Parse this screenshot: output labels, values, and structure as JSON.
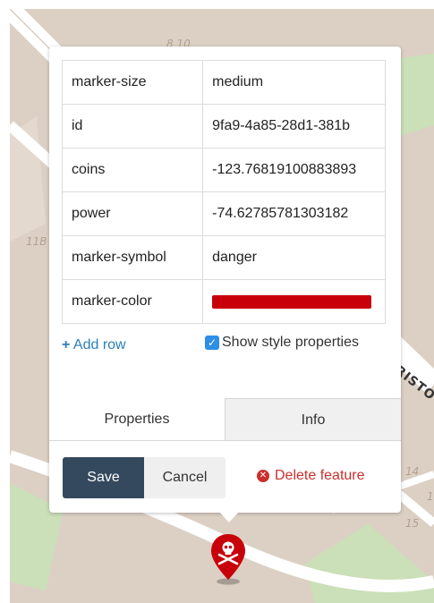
{
  "map": {
    "labels": [
      "8 10",
      "11B",
      "14",
      "15",
      "1"
    ],
    "street_label": "RISTO"
  },
  "popup": {
    "properties": [
      {
        "key": "marker-size",
        "value": "medium"
      },
      {
        "key": "id",
        "value": "9fa9-4a85-28d1-381b"
      },
      {
        "key": "coins",
        "value": "-123.76819100883893"
      },
      {
        "key": "power",
        "value": "-74.62785781303182"
      },
      {
        "key": "marker-symbol",
        "value": "danger"
      },
      {
        "key": "marker-color",
        "value": "",
        "color": "#c8000a"
      }
    ],
    "add_row_plus": "+",
    "add_row_label": "Add row",
    "show_style_label": "Show style properties",
    "show_style_checked": true,
    "tabs": [
      {
        "label": "Properties",
        "active": true
      },
      {
        "label": "Info",
        "active": false
      }
    ],
    "save_label": "Save",
    "cancel_label": "Cancel",
    "delete_label": "Delete feature"
  },
  "colors": {
    "map_bg": "#dcd0c4",
    "park": "#cbdfb8",
    "road": "#ffffff",
    "accent_button": "#34495e",
    "delete": "#c9302c",
    "marker": "#c8000a"
  },
  "marker": {
    "icon": "danger-skull-icon"
  }
}
